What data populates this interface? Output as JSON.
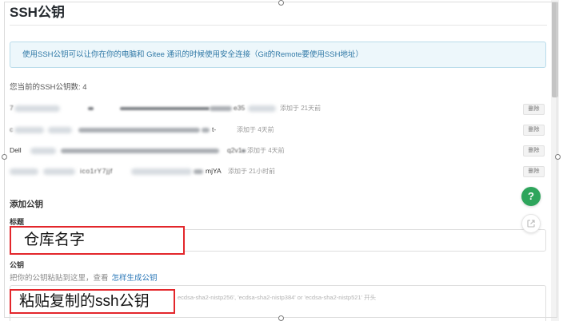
{
  "page": {
    "title": "SSH公钥",
    "info": "使用SSH公钥可以让你在你的电脑和 Gitee 通讯的时候使用安全连接（Git的Remote要使用SSH地址）"
  },
  "keys": {
    "count_label": "您当前的SSH公钥数: 4",
    "items": [
      {
        "title_fragment": "7",
        "fingerprint_fragment": "e35",
        "added": "添加于 21天前",
        "delete_label": "删除"
      },
      {
        "title_fragment": "c",
        "fingerprint_fragment": "t-",
        "added": "添加于 4天前",
        "delete_label": "删除"
      },
      {
        "title_fragment": "Dell",
        "fingerprint_fragment": "q2v1",
        "added": "添加于 4天前",
        "delete_label": "删除"
      },
      {
        "title_fragment": "ico1rY7jjf",
        "fingerprint_fragment": "mjYA",
        "added": "添加于 21小时前",
        "delete_label": "删除"
      }
    ]
  },
  "add_key": {
    "heading": "添加公钥",
    "title_label": "标题",
    "key_label": "公钥",
    "key_hint": "把你的公钥粘贴到这里，查看",
    "key_hint_link": "怎样生成公钥",
    "key_placeholder": "ecdsa-sha2-nistp256', 'ecdsa-sha2-nistp384' or 'ecdsa-sha2-nistp521' 开头"
  },
  "annotations": {
    "title_note": "仓库名字",
    "key_note": "粘贴复制的ssh公钥"
  },
  "floating": {
    "help_glyph": "?",
    "help_icon": "question-icon",
    "share_icon": "external-link-icon"
  },
  "colors": {
    "accent_green": "#2ea55c",
    "link_blue": "#2c78b8",
    "annotation_red": "#e3262b",
    "info_background": "#edf7fb",
    "info_border": "#b9dcea",
    "info_text": "#2f78a6"
  }
}
